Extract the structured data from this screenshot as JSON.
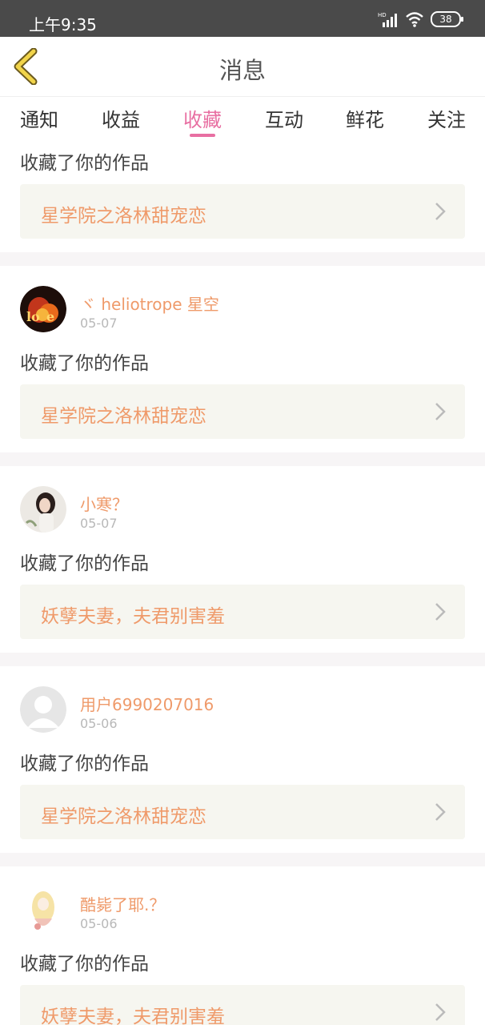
{
  "status_bar": {
    "time": "上午9:35",
    "battery": "38"
  },
  "header": {
    "title": "消息"
  },
  "tabs": [
    {
      "label": "通知"
    },
    {
      "label": "收益"
    },
    {
      "label": "收藏"
    },
    {
      "label": "互动"
    },
    {
      "label": "鲜花"
    },
    {
      "label": "关注"
    }
  ],
  "active_tab": "收藏",
  "colors": {
    "accent": "#e86fa2",
    "name": "#ef9a6a",
    "card_bg": "#f6f6f0"
  },
  "items": [
    {
      "action": "收藏了你的作品",
      "work_title": "星学院之洛林甜宠恋"
    },
    {
      "username": "ヾ heliotrope 星空",
      "date": "05-07",
      "action": "收藏了你的作品",
      "work_title": "星学院之洛林甜宠恋",
      "avatar": "fire-love-avatar"
    },
    {
      "username": "小寒？",
      "date": "05-07",
      "action": "收藏了你的作品",
      "work_title": "妖孽夫妻，夫君别害羞",
      "avatar": "girl-photo-avatar"
    },
    {
      "username": "用户6990207016",
      "date": "05-06",
      "action": "收藏了你的作品",
      "work_title": "星学院之洛林甜宠恋",
      "avatar": "default-user-avatar"
    },
    {
      "username": "酷毙了耶.？",
      "date": "05-06",
      "action": "收藏了你的作品",
      "work_title": "妖孽夫妻，夫君别害羞",
      "avatar": "anime-girl-avatar"
    }
  ]
}
